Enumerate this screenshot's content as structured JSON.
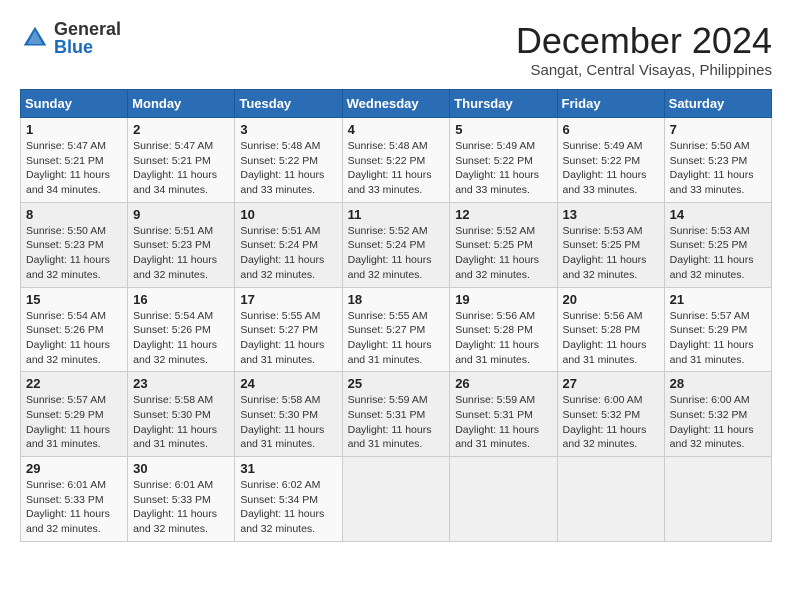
{
  "header": {
    "logo": {
      "general": "General",
      "blue": "Blue"
    },
    "title": "December 2024",
    "subtitle": "Sangat, Central Visayas, Philippines"
  },
  "calendar": {
    "days_of_week": [
      "Sunday",
      "Monday",
      "Tuesday",
      "Wednesday",
      "Thursday",
      "Friday",
      "Saturday"
    ],
    "weeks": [
      [
        {
          "day": "",
          "info": ""
        },
        {
          "day": "2",
          "info": "Sunrise: 5:47 AM\nSunset: 5:21 PM\nDaylight: 11 hours\nand 34 minutes."
        },
        {
          "day": "3",
          "info": "Sunrise: 5:48 AM\nSunset: 5:22 PM\nDaylight: 11 hours\nand 33 minutes."
        },
        {
          "day": "4",
          "info": "Sunrise: 5:48 AM\nSunset: 5:22 PM\nDaylight: 11 hours\nand 33 minutes."
        },
        {
          "day": "5",
          "info": "Sunrise: 5:49 AM\nSunset: 5:22 PM\nDaylight: 11 hours\nand 33 minutes."
        },
        {
          "day": "6",
          "info": "Sunrise: 5:49 AM\nSunset: 5:22 PM\nDaylight: 11 hours\nand 33 minutes."
        },
        {
          "day": "7",
          "info": "Sunrise: 5:50 AM\nSunset: 5:23 PM\nDaylight: 11 hours\nand 33 minutes."
        }
      ],
      [
        {
          "day": "1",
          "info": "Sunrise: 5:47 AM\nSunset: 5:21 PM\nDaylight: 11 hours\nand 34 minutes."
        },
        {
          "day": "9",
          "info": "Sunrise: 5:51 AM\nSunset: 5:23 PM\nDaylight: 11 hours\nand 32 minutes."
        },
        {
          "day": "10",
          "info": "Sunrise: 5:51 AM\nSunset: 5:24 PM\nDaylight: 11 hours\nand 32 minutes."
        },
        {
          "day": "11",
          "info": "Sunrise: 5:52 AM\nSunset: 5:24 PM\nDaylight: 11 hours\nand 32 minutes."
        },
        {
          "day": "12",
          "info": "Sunrise: 5:52 AM\nSunset: 5:25 PM\nDaylight: 11 hours\nand 32 minutes."
        },
        {
          "day": "13",
          "info": "Sunrise: 5:53 AM\nSunset: 5:25 PM\nDaylight: 11 hours\nand 32 minutes."
        },
        {
          "day": "14",
          "info": "Sunrise: 5:53 AM\nSunset: 5:25 PM\nDaylight: 11 hours\nand 32 minutes."
        }
      ],
      [
        {
          "day": "8",
          "info": "Sunrise: 5:50 AM\nSunset: 5:23 PM\nDaylight: 11 hours\nand 32 minutes."
        },
        {
          "day": "16",
          "info": "Sunrise: 5:54 AM\nSunset: 5:26 PM\nDaylight: 11 hours\nand 32 minutes."
        },
        {
          "day": "17",
          "info": "Sunrise: 5:55 AM\nSunset: 5:27 PM\nDaylight: 11 hours\nand 31 minutes."
        },
        {
          "day": "18",
          "info": "Sunrise: 5:55 AM\nSunset: 5:27 PM\nDaylight: 11 hours\nand 31 minutes."
        },
        {
          "day": "19",
          "info": "Sunrise: 5:56 AM\nSunset: 5:28 PM\nDaylight: 11 hours\nand 31 minutes."
        },
        {
          "day": "20",
          "info": "Sunrise: 5:56 AM\nSunset: 5:28 PM\nDaylight: 11 hours\nand 31 minutes."
        },
        {
          "day": "21",
          "info": "Sunrise: 5:57 AM\nSunset: 5:29 PM\nDaylight: 11 hours\nand 31 minutes."
        }
      ],
      [
        {
          "day": "15",
          "info": "Sunrise: 5:54 AM\nSunset: 5:26 PM\nDaylight: 11 hours\nand 32 minutes."
        },
        {
          "day": "23",
          "info": "Sunrise: 5:58 AM\nSunset: 5:30 PM\nDaylight: 11 hours\nand 31 minutes."
        },
        {
          "day": "24",
          "info": "Sunrise: 5:58 AM\nSunset: 5:30 PM\nDaylight: 11 hours\nand 31 minutes."
        },
        {
          "day": "25",
          "info": "Sunrise: 5:59 AM\nSunset: 5:31 PM\nDaylight: 11 hours\nand 31 minutes."
        },
        {
          "day": "26",
          "info": "Sunrise: 5:59 AM\nSunset: 5:31 PM\nDaylight: 11 hours\nand 31 minutes."
        },
        {
          "day": "27",
          "info": "Sunrise: 6:00 AM\nSunset: 5:32 PM\nDaylight: 11 hours\nand 32 minutes."
        },
        {
          "day": "28",
          "info": "Sunrise: 6:00 AM\nSunset: 5:32 PM\nDaylight: 11 hours\nand 32 minutes."
        }
      ],
      [
        {
          "day": "22",
          "info": "Sunrise: 5:57 AM\nSunset: 5:29 PM\nDaylight: 11 hours\nand 31 minutes."
        },
        {
          "day": "30",
          "info": "Sunrise: 6:01 AM\nSunset: 5:33 PM\nDaylight: 11 hours\nand 32 minutes."
        },
        {
          "day": "31",
          "info": "Sunrise: 6:02 AM\nSunset: 5:34 PM\nDaylight: 11 hours\nand 32 minutes."
        },
        {
          "day": "",
          "info": ""
        },
        {
          "day": "",
          "info": ""
        },
        {
          "day": "",
          "info": ""
        },
        {
          "day": "",
          "info": ""
        }
      ],
      [
        {
          "day": "29",
          "info": "Sunrise: 6:01 AM\nSunset: 5:33 PM\nDaylight: 11 hours\nand 32 minutes."
        },
        {
          "day": "",
          "info": ""
        },
        {
          "day": "",
          "info": ""
        },
        {
          "day": "",
          "info": ""
        },
        {
          "day": "",
          "info": ""
        },
        {
          "day": "",
          "info": ""
        },
        {
          "day": "",
          "info": ""
        }
      ]
    ]
  }
}
